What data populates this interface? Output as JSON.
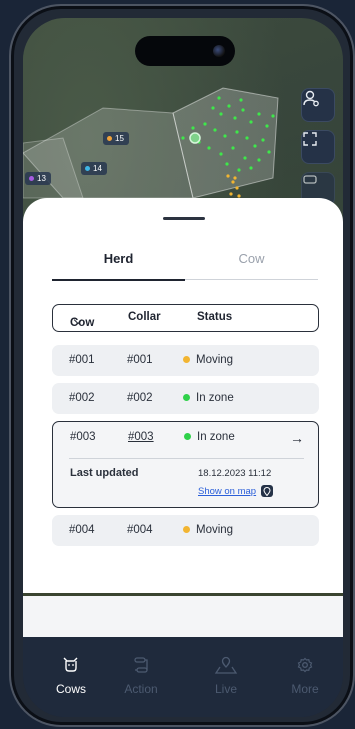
{
  "map": {
    "pins": [
      {
        "label": "15",
        "color": "#f0a23a"
      },
      {
        "label": "14",
        "color": "#3fb6e6"
      },
      {
        "label": "13",
        "color": "#a65be0"
      }
    ]
  },
  "sheet": {
    "tabs": [
      {
        "label": "Herd",
        "active": true
      },
      {
        "label": "Cow",
        "active": false
      }
    ],
    "header": {
      "cow": "Cow",
      "collar": "Collar",
      "status": "Status"
    },
    "rows": [
      {
        "cow": "#001",
        "collar": "#001",
        "status": "Moving",
        "status_color": "#f2b531"
      },
      {
        "cow": "#002",
        "collar": "#002",
        "status": "In zone",
        "status_color": "#2fd14a"
      },
      {
        "cow": "#003",
        "collar": "#003",
        "status": "In zone",
        "status_color": "#2fd14a",
        "last_updated_label": "Last updated",
        "last_updated_value": "18.12.2023  11:12",
        "show_on_map": "Show on map"
      },
      {
        "cow": "#004",
        "collar": "#004",
        "status": "Moving",
        "status_color": "#f2b531"
      }
    ]
  },
  "tabbar": {
    "items": [
      {
        "label": "Cows",
        "icon": "cow-icon",
        "active": true
      },
      {
        "label": "Action",
        "icon": "route-icon",
        "active": false
      },
      {
        "label": "Live",
        "icon": "map-pin-icon",
        "active": false
      },
      {
        "label": "More",
        "icon": "gear-icon",
        "active": false
      }
    ]
  }
}
